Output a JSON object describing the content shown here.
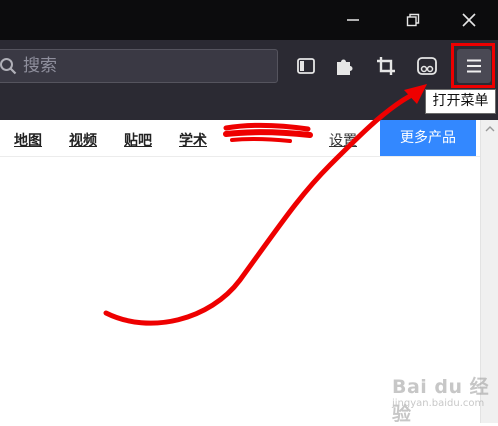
{
  "toolbar": {
    "search_placeholder": "搜索"
  },
  "menu_tooltip": "打开菜单",
  "baidu_nav": {
    "links": [
      "地图",
      "视频",
      "贴吧",
      "学术"
    ],
    "settings": "设置",
    "more_button": "更多产品"
  },
  "watermark": {
    "main": "Bai du 经验",
    "sub": "jingyan.baidu.com"
  },
  "colors": {
    "annotation_red": "#ee0000",
    "more_button_blue": "#3388ff",
    "toolbar_bg": "#2b2a33",
    "titlebar_bg": "#0c0c0d"
  },
  "icons": {
    "window": [
      "restore-icon",
      "close-icon"
    ],
    "toolbar": [
      "sidebar-icon",
      "extensions-icon",
      "crop-icon",
      "reader-icon",
      "hamburger-menu-icon"
    ]
  }
}
